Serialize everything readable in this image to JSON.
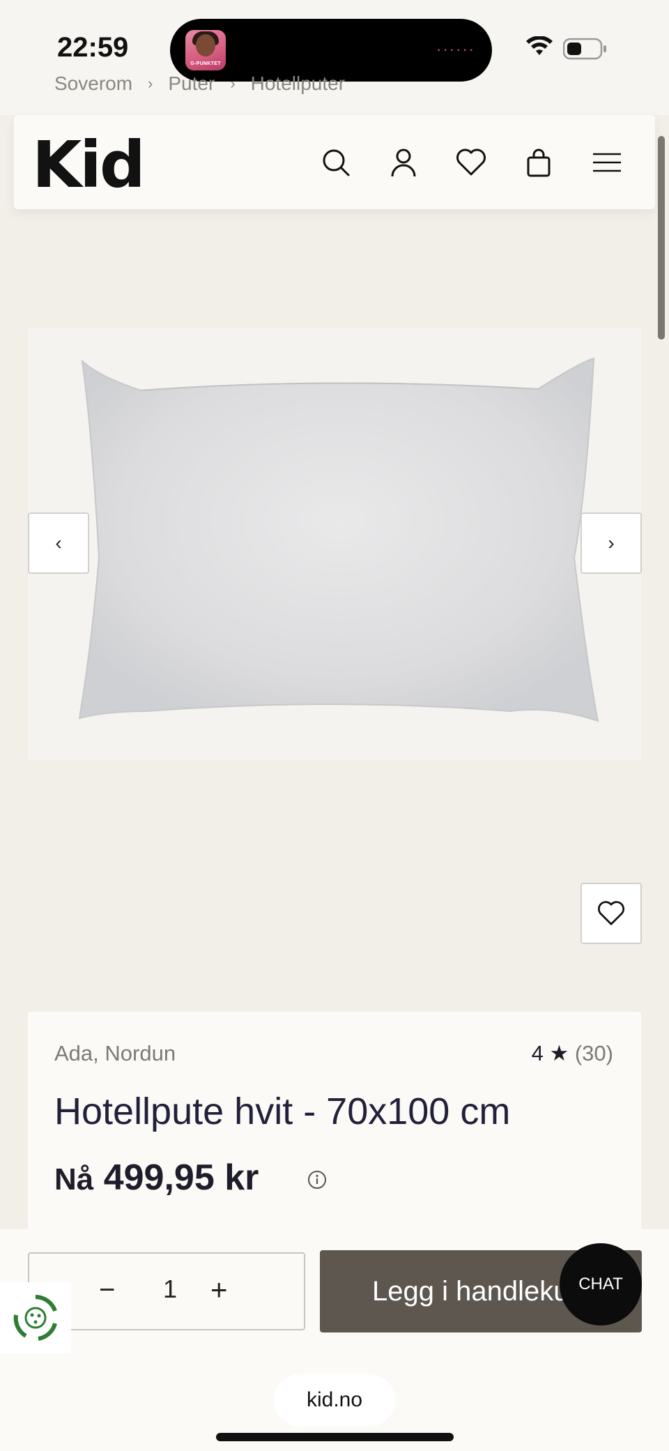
{
  "status": {
    "time": "22:59",
    "app_badge_text": "G-PUNKTET"
  },
  "breadcrumb": [
    "Soverom",
    "Puter",
    "Hotellputer"
  ],
  "header": {
    "logo": "Kid",
    "icons": [
      "search-icon",
      "account-icon",
      "wishlist-icon",
      "cart-icon",
      "menu-icon"
    ]
  },
  "gallery": {
    "prev_label": "‹",
    "next_label": "›"
  },
  "product": {
    "brand": "Ada, Nordun",
    "rating": "4",
    "rating_count": "(30)",
    "title": "Hotellpute hvit - 70x100 cm",
    "price_prefix": "Nå",
    "price": "499,95 kr"
  },
  "cart": {
    "quantity": "1",
    "add_label": "Legg i handlekurv",
    "chat_label": "CHAT"
  },
  "browser": {
    "url": "kid.no"
  },
  "colors": {
    "page_bg": "#f2efe9",
    "card_bg": "#fbfaf6",
    "button_bg": "#5d5750",
    "recycle_green": "#2e7d32"
  }
}
